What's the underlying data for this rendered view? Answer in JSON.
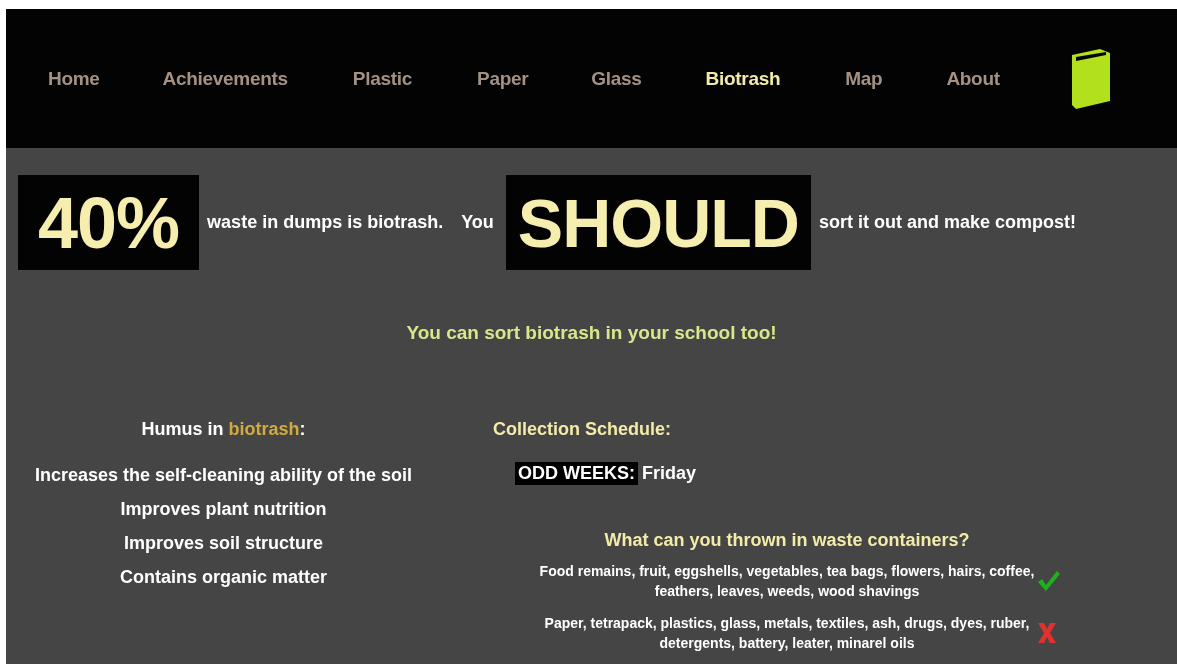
{
  "nav": {
    "items": [
      {
        "label": "Home",
        "selected": false
      },
      {
        "label": "Achievements",
        "selected": false
      },
      {
        "label": "Plastic",
        "selected": false
      },
      {
        "label": "Paper",
        "selected": false
      },
      {
        "label": "Glass",
        "selected": false
      },
      {
        "label": "Biotrash",
        "selected": true
      },
      {
        "label": "Map",
        "selected": false
      },
      {
        "label": "About",
        "selected": false
      }
    ]
  },
  "headline": {
    "stat": "40%",
    "text_1": "waste in dumps is biotrash.",
    "text_2": "You",
    "emphasis": "SHOULD",
    "text_3": "sort it out and make compost!"
  },
  "tagline": "You can sort biotrash in your school too!",
  "humus": {
    "title_1": "Humus in",
    "title_highlight": "biotrash",
    "title_2": ":",
    "benefits": [
      "Increases the self-cleaning ability of the soil",
      "Improves plant nutrition",
      "Improves soil structure",
      "Contains organic matter"
    ]
  },
  "schedule": {
    "title": "Collection Schedule:",
    "label": "ODD WEEKS:",
    "day": "Friday"
  },
  "containers": {
    "title": "What can you thrown in waste containers?",
    "items": [
      {
        "kind": "allowed",
        "text": "Food remains, fruit, eggshells, vegetables, tea bags, flowers, hairs, coffee, feathers, leaves, weeds, wood shavings"
      },
      {
        "kind": "forbidden",
        "text": "Paper, tetrapack, plastics, glass, metals, textiles, ash, drugs, dyes, ruber, detergents, battery, leater, minarel oils"
      }
    ]
  }
}
